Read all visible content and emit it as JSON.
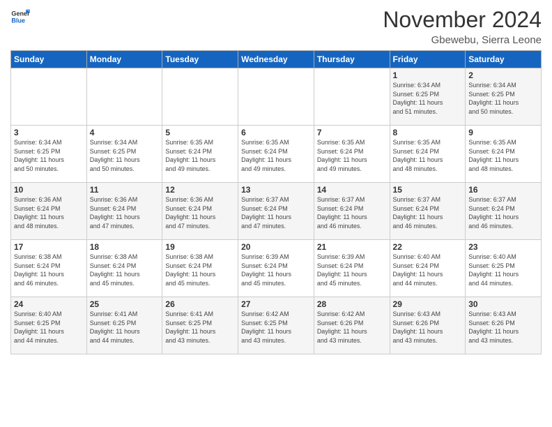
{
  "logo": {
    "general": "General",
    "blue": "Blue"
  },
  "header": {
    "month": "November 2024",
    "location": "Gbewebu, Sierra Leone"
  },
  "weekdays": [
    "Sunday",
    "Monday",
    "Tuesday",
    "Wednesday",
    "Thursday",
    "Friday",
    "Saturday"
  ],
  "weeks": [
    [
      {
        "day": "",
        "info": ""
      },
      {
        "day": "",
        "info": ""
      },
      {
        "day": "",
        "info": ""
      },
      {
        "day": "",
        "info": ""
      },
      {
        "day": "",
        "info": ""
      },
      {
        "day": "1",
        "info": "Sunrise: 6:34 AM\nSunset: 6:25 PM\nDaylight: 11 hours\nand 51 minutes."
      },
      {
        "day": "2",
        "info": "Sunrise: 6:34 AM\nSunset: 6:25 PM\nDaylight: 11 hours\nand 50 minutes."
      }
    ],
    [
      {
        "day": "3",
        "info": "Sunrise: 6:34 AM\nSunset: 6:25 PM\nDaylight: 11 hours\nand 50 minutes."
      },
      {
        "day": "4",
        "info": "Sunrise: 6:34 AM\nSunset: 6:25 PM\nDaylight: 11 hours\nand 50 minutes."
      },
      {
        "day": "5",
        "info": "Sunrise: 6:35 AM\nSunset: 6:24 PM\nDaylight: 11 hours\nand 49 minutes."
      },
      {
        "day": "6",
        "info": "Sunrise: 6:35 AM\nSunset: 6:24 PM\nDaylight: 11 hours\nand 49 minutes."
      },
      {
        "day": "7",
        "info": "Sunrise: 6:35 AM\nSunset: 6:24 PM\nDaylight: 11 hours\nand 49 minutes."
      },
      {
        "day": "8",
        "info": "Sunrise: 6:35 AM\nSunset: 6:24 PM\nDaylight: 11 hours\nand 48 minutes."
      },
      {
        "day": "9",
        "info": "Sunrise: 6:35 AM\nSunset: 6:24 PM\nDaylight: 11 hours\nand 48 minutes."
      }
    ],
    [
      {
        "day": "10",
        "info": "Sunrise: 6:36 AM\nSunset: 6:24 PM\nDaylight: 11 hours\nand 48 minutes."
      },
      {
        "day": "11",
        "info": "Sunrise: 6:36 AM\nSunset: 6:24 PM\nDaylight: 11 hours\nand 47 minutes."
      },
      {
        "day": "12",
        "info": "Sunrise: 6:36 AM\nSunset: 6:24 PM\nDaylight: 11 hours\nand 47 minutes."
      },
      {
        "day": "13",
        "info": "Sunrise: 6:37 AM\nSunset: 6:24 PM\nDaylight: 11 hours\nand 47 minutes."
      },
      {
        "day": "14",
        "info": "Sunrise: 6:37 AM\nSunset: 6:24 PM\nDaylight: 11 hours\nand 46 minutes."
      },
      {
        "day": "15",
        "info": "Sunrise: 6:37 AM\nSunset: 6:24 PM\nDaylight: 11 hours\nand 46 minutes."
      },
      {
        "day": "16",
        "info": "Sunrise: 6:37 AM\nSunset: 6:24 PM\nDaylight: 11 hours\nand 46 minutes."
      }
    ],
    [
      {
        "day": "17",
        "info": "Sunrise: 6:38 AM\nSunset: 6:24 PM\nDaylight: 11 hours\nand 46 minutes."
      },
      {
        "day": "18",
        "info": "Sunrise: 6:38 AM\nSunset: 6:24 PM\nDaylight: 11 hours\nand 45 minutes."
      },
      {
        "day": "19",
        "info": "Sunrise: 6:38 AM\nSunset: 6:24 PM\nDaylight: 11 hours\nand 45 minutes."
      },
      {
        "day": "20",
        "info": "Sunrise: 6:39 AM\nSunset: 6:24 PM\nDaylight: 11 hours\nand 45 minutes."
      },
      {
        "day": "21",
        "info": "Sunrise: 6:39 AM\nSunset: 6:24 PM\nDaylight: 11 hours\nand 45 minutes."
      },
      {
        "day": "22",
        "info": "Sunrise: 6:40 AM\nSunset: 6:24 PM\nDaylight: 11 hours\nand 44 minutes."
      },
      {
        "day": "23",
        "info": "Sunrise: 6:40 AM\nSunset: 6:25 PM\nDaylight: 11 hours\nand 44 minutes."
      }
    ],
    [
      {
        "day": "24",
        "info": "Sunrise: 6:40 AM\nSunset: 6:25 PM\nDaylight: 11 hours\nand 44 minutes."
      },
      {
        "day": "25",
        "info": "Sunrise: 6:41 AM\nSunset: 6:25 PM\nDaylight: 11 hours\nand 44 minutes."
      },
      {
        "day": "26",
        "info": "Sunrise: 6:41 AM\nSunset: 6:25 PM\nDaylight: 11 hours\nand 43 minutes."
      },
      {
        "day": "27",
        "info": "Sunrise: 6:42 AM\nSunset: 6:25 PM\nDaylight: 11 hours\nand 43 minutes."
      },
      {
        "day": "28",
        "info": "Sunrise: 6:42 AM\nSunset: 6:26 PM\nDaylight: 11 hours\nand 43 minutes."
      },
      {
        "day": "29",
        "info": "Sunrise: 6:43 AM\nSunset: 6:26 PM\nDaylight: 11 hours\nand 43 minutes."
      },
      {
        "day": "30",
        "info": "Sunrise: 6:43 AM\nSunset: 6:26 PM\nDaylight: 11 hours\nand 43 minutes."
      }
    ]
  ]
}
